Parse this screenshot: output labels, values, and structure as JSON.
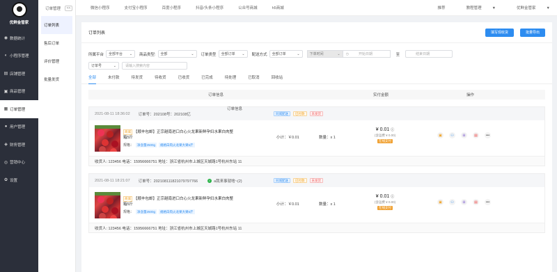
{
  "brand": {
    "name": "优鲜金管家"
  },
  "nav": [
    {
      "icon": "dashboard-icon",
      "glyph": "◉",
      "label": "数据统计"
    },
    {
      "icon": "miniprogram-icon",
      "glyph": "◐",
      "label": "小程序管理"
    },
    {
      "icon": "store-icon",
      "glyph": "▤",
      "label": "店铺管理"
    },
    {
      "icon": "goods-icon",
      "glyph": "▣",
      "label": "商品管理"
    },
    {
      "icon": "order-icon",
      "glyph": "▦",
      "label": "订单管理"
    },
    {
      "icon": "user-icon",
      "glyph": "●",
      "label": "用户管理"
    },
    {
      "icon": "finance-icon",
      "glyph": "◈",
      "label": "财务管理"
    },
    {
      "icon": "marketing-icon",
      "glyph": "◎",
      "label": "营销中心"
    },
    {
      "icon": "settings-icon",
      "glyph": "✿",
      "label": "设置"
    }
  ],
  "subnav": {
    "header": "订单管理",
    "collapse": "<<",
    "items": [
      "订单列表",
      "售后订单",
      "评价管理",
      "批量发货"
    ]
  },
  "topbar": {
    "tabs": [
      "微信小程序",
      "支付宝小程序",
      "百度小程序",
      "抖音/头条小程序",
      "公众号商城",
      "h5商城"
    ],
    "right": {
      "support": "推荐",
      "tutorial": "教程管理",
      "user": "优鲜金管家"
    }
  },
  "page": {
    "title": "订单列表",
    "buttons": {
      "batch_ship": "填写现收货",
      "export": "批量导出"
    }
  },
  "filters": {
    "platform_label": "所属平台",
    "platform_value": "全部平台",
    "product_type_label": "商品类型:",
    "product_type_value": "全部",
    "order_type_label": "订单类型",
    "order_type_value": "全部订单",
    "delivery_label": "配送方式",
    "delivery_value": "全部订单",
    "date_type": "下单时间",
    "start_date": "开始日期",
    "to": "至",
    "end_date": "结束日期",
    "search_field": "订单号",
    "search_placeholder": "请输入搜索内容"
  },
  "status_tabs": [
    "全部",
    "未付款",
    "待发货",
    "待收货",
    "已收货",
    "已完成",
    "待处理",
    "已取消",
    "回收站"
  ],
  "table_header": {
    "order_info": "订单信息",
    "paid": "实付金额",
    "actions": "操作"
  },
  "orders": [
    {
      "time": "2021-08-11 18:36:02",
      "order_no": "订单号：202108号：202108亿",
      "overlay": "订单信息",
      "platform_icon": "",
      "buyer": "",
      "badges": [
        "同城配送",
        "已付款",
        "未发货"
      ],
      "product_tag": "商城",
      "product_title": "【顺丰包邮】正宗越南进口白心火龙果新鲜孕妇水果白肉整箱5斤",
      "spec_label": "规格：",
      "spec_tags": [
        "净含量2500g",
        "规格白肉火龙果大果5斤"
      ],
      "subtotal": "小计：￥0.01",
      "qty": "数量：x 1",
      "paid_amount": "¥ 0.01",
      "paid_sub": "(含运费 ¥ 0.00)",
      "pay_tag": "在线支付",
      "recipient": "收货人: 123456  电话：15956666751  地址：浙江省杭州市上城区天城路1号杭州东站 11"
    },
    {
      "time": "2021-08-11 18:21:07",
      "order_no": "订单号：202108111821079797766",
      "overlay": "",
      "platform_icon": "wechat-icon",
      "buyer": "a我来事就啥~(2)",
      "badges": [
        "同城配送",
        "已付款",
        "未发货"
      ],
      "product_tag": "商城",
      "product_title": "【顺丰包邮】正宗越南进口白心火龙果新鲜孕妇水果白肉整箱5斤",
      "spec_label": "规格：",
      "spec_tags": [
        "净含量2500g",
        "规格白肉火龙果大果5斤"
      ],
      "subtotal": "小计：￥0.01",
      "qty": "数量：x 1",
      "paid_amount": "¥ 0.01",
      "paid_sub": "(含运费 ¥ 0.00)",
      "pay_tag": "在线支付",
      "recipient": "收货人: 123456  电话：15956666751  地址：浙江省杭州市上城区天城路1号杭州东站 11"
    }
  ],
  "action_icons": [
    "print-icon",
    "share-icon",
    "cart-icon",
    "message-icon",
    "more-icon"
  ],
  "more_glyph": "•••"
}
